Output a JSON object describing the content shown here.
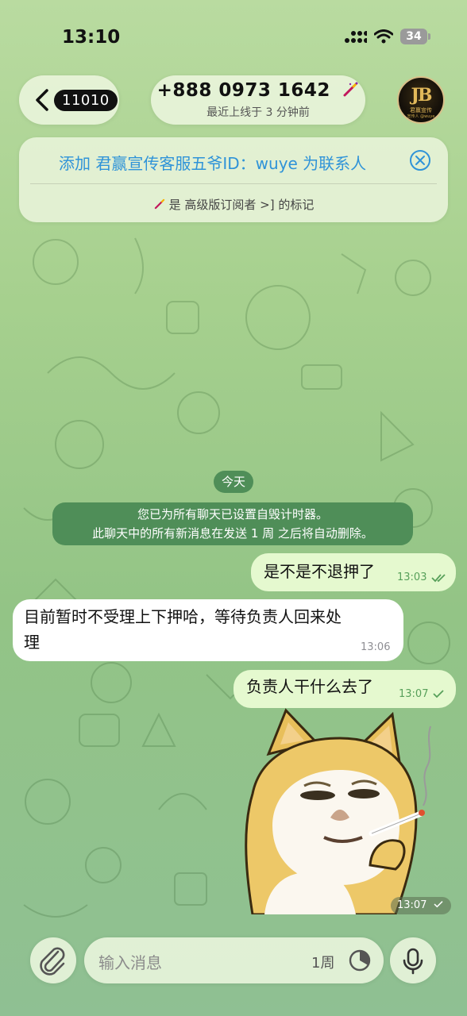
{
  "status_bar": {
    "time": "13:10",
    "battery": "34"
  },
  "header": {
    "back_count": "11010",
    "contact_name": "+888 0973 1642",
    "last_seen": "最近上线于 3 分钟前",
    "avatar_logo": "JB",
    "avatar_sub": "君赢宣传",
    "avatar_sub2": "宣传人 @wuye"
  },
  "add_contact": {
    "text": "添加 君赢宣传客服五爷ID：wuye 为联系人",
    "premium_note": "是 高级版订阅者 >] 的标记"
  },
  "chat": {
    "date_chip": "今天",
    "service_line1": "您已为所有聊天已设置自毁计时器。",
    "service_line2": "此聊天中的所有新消息在发送 1 周 之后将自动删除。",
    "messages": [
      {
        "direction": "out",
        "text": "是不是不退押了",
        "time": "13:03",
        "status": "read"
      },
      {
        "direction": "in",
        "text_line1": "目前暂时不受理上下押哈，等待负责人回来处",
        "text_line2": "理",
        "time": "13:06"
      },
      {
        "direction": "out",
        "text": "负责人干什么去了",
        "time": "13:07",
        "status": "sent"
      },
      {
        "direction": "out",
        "type": "sticker",
        "sticker": "shiba-doge-smoking-sticker",
        "time": "13:07",
        "status": "sent"
      }
    ]
  },
  "input_bar": {
    "placeholder": "输入消息",
    "timer_label": "1周"
  },
  "colors": {
    "accent_blue": "#2f93d8",
    "outgoing_bubble": "#e5f9cf",
    "service_green": "#4f8e58"
  }
}
